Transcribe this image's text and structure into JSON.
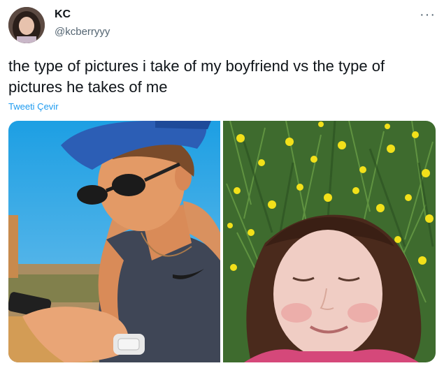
{
  "tweet": {
    "author_name": "KC",
    "author_handle": "@kcberryyy",
    "more_icon": "more-horizontal-icon",
    "text": "the type of pictures i take of my boyfriend vs the type of pictures he takes of me",
    "translate_label": "Tweeti Çevir"
  },
  "media": {
    "photos": [
      "boyfriend-photo",
      "girlfriend-photo"
    ]
  },
  "colors": {
    "link": "#1d9bf0",
    "secondary_text": "#536471",
    "primary_text": "#0f1419"
  }
}
